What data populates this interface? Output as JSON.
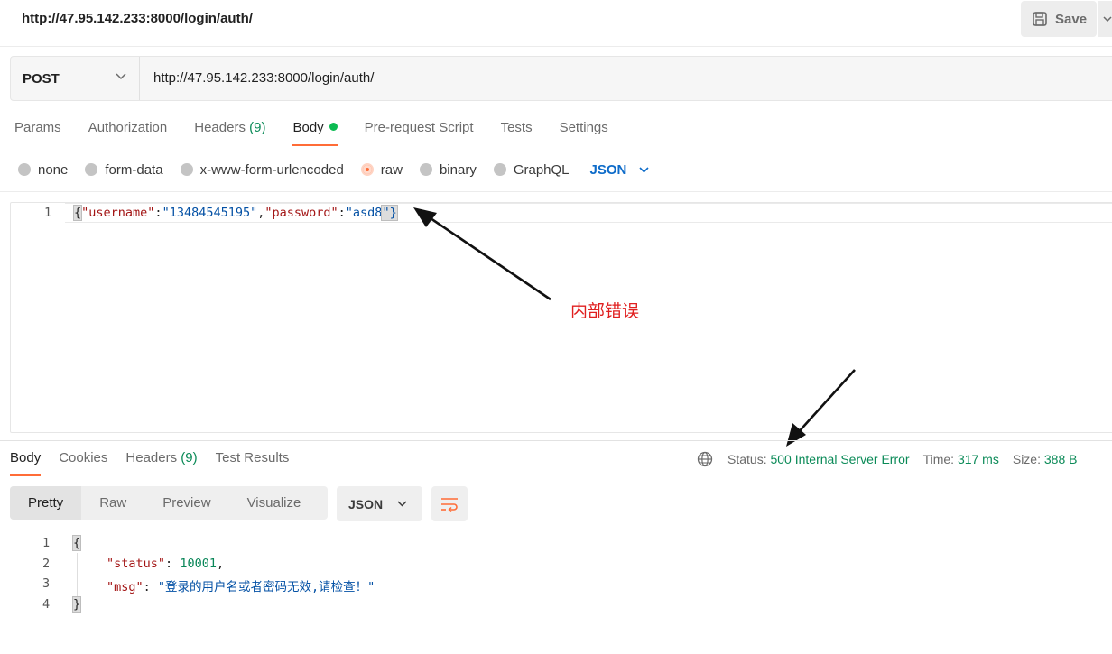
{
  "title_bar": {
    "title": "http://47.95.142.233:8000/login/auth/",
    "save_label": "Save"
  },
  "request": {
    "method": "POST",
    "url": "http://47.95.142.233:8000/login/auth/"
  },
  "request_tabs": [
    {
      "label": "Params"
    },
    {
      "label": "Authorization"
    },
    {
      "label": "Headers",
      "count": "(9)"
    },
    {
      "label": "Body"
    },
    {
      "label": "Pre-request Script"
    },
    {
      "label": "Tests"
    },
    {
      "label": "Settings"
    }
  ],
  "body_types": [
    {
      "label": "none"
    },
    {
      "label": "form-data"
    },
    {
      "label": "x-www-form-urlencoded"
    },
    {
      "label": "raw",
      "selected": true
    },
    {
      "label": "binary"
    },
    {
      "label": "GraphQL"
    }
  ],
  "body_format": "JSON",
  "request_body": {
    "line_number": "1",
    "tokens": {
      "open": "{",
      "k1": "\"username\"",
      "c1": ":",
      "v1": "\"13484545195\"",
      "comma": ",",
      "k2": "\"password\"",
      "c2": ":",
      "v2": "\"asd8",
      "close": "\"}"
    }
  },
  "annotation": {
    "text": "内部错误",
    "color": "#e02020"
  },
  "response_tabs": [
    {
      "label": "Body"
    },
    {
      "label": "Cookies"
    },
    {
      "label": "Headers",
      "count": "(9)"
    },
    {
      "label": "Test Results"
    }
  ],
  "response_status": {
    "status_label": "Status:",
    "status_value": "500 Internal Server Error",
    "time_label": "Time:",
    "time_value": "317 ms",
    "size_label": "Size:",
    "size_value": "388 B"
  },
  "view_modes": [
    "Pretty",
    "Raw",
    "Preview",
    "Visualize"
  ],
  "response_format": "JSON",
  "response_body": {
    "line_numbers": [
      "1",
      "2",
      "3",
      "4"
    ],
    "open": "{",
    "status_key": "\"status\"",
    "status_colon": ":",
    "status_value": "10001",
    "status_comma": ",",
    "msg_key": "\"msg\"",
    "msg_colon": ":",
    "msg_value": "\"登录的用户名或者密码无效,请检查！\"",
    "close": "}"
  },
  "colors": {
    "accent": "#ff6c37",
    "success": "#0a8a57",
    "json_key": "#a31515",
    "json_string": "#0451a5",
    "json_number": "#098658",
    "link_blue": "#0d6bc9"
  }
}
